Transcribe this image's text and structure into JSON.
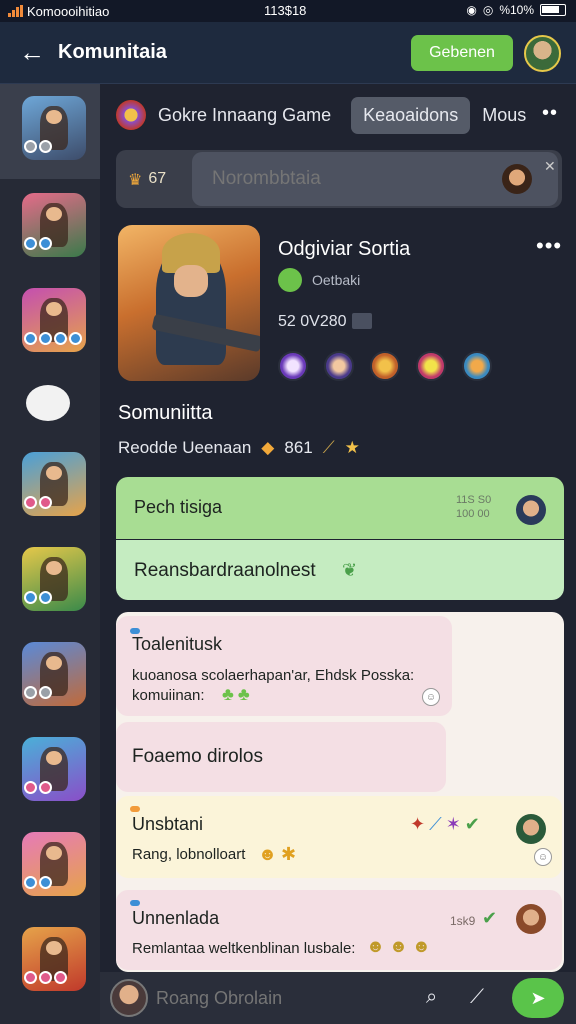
{
  "status_bar": {
    "app_label": "Komoooihitiao",
    "time": "113$18",
    "battery": "%10%"
  },
  "header": {
    "title": "Komunitaia",
    "primary_button": "Gebenen"
  },
  "tabs": [
    {
      "label": "Gokre Innaang Game"
    },
    {
      "label": "Keaoaidons",
      "active": true
    },
    {
      "label": "Mous"
    }
  ],
  "search": {
    "count": "67",
    "placeholder": "Norombbtaia"
  },
  "game": {
    "name": "Odgiviar Sortia",
    "developer": "Oetbaki",
    "members": "52 0V280"
  },
  "community": {
    "title": "Somuniitta",
    "meta": "Reodde Ueenaan",
    "meta_count": "861"
  },
  "messages": [
    {
      "title": "Pech tisiga",
      "timestamp": "11S S0\n100 00",
      "body": "Reansbardraanolnest"
    },
    {
      "title": "Toalenitusk",
      "body": "kuoanosa scolaerhapan'ar, Ehdsk Posska: komuiinan:"
    },
    {
      "title": "Foaemo dirolos"
    },
    {
      "title": "Unsbtani",
      "body": "Rang, lobnolloart"
    },
    {
      "title": "Unnenlada",
      "timestamp": "1sk9",
      "body": "Remlantaa weltkenblinan lusbale:"
    }
  ],
  "composer": {
    "placeholder": "Roang Obrolain"
  },
  "colors": {
    "accent_green": "#6cc24a",
    "header_bg": "#1e2a3e",
    "sidebar_bg": "#262a36"
  }
}
